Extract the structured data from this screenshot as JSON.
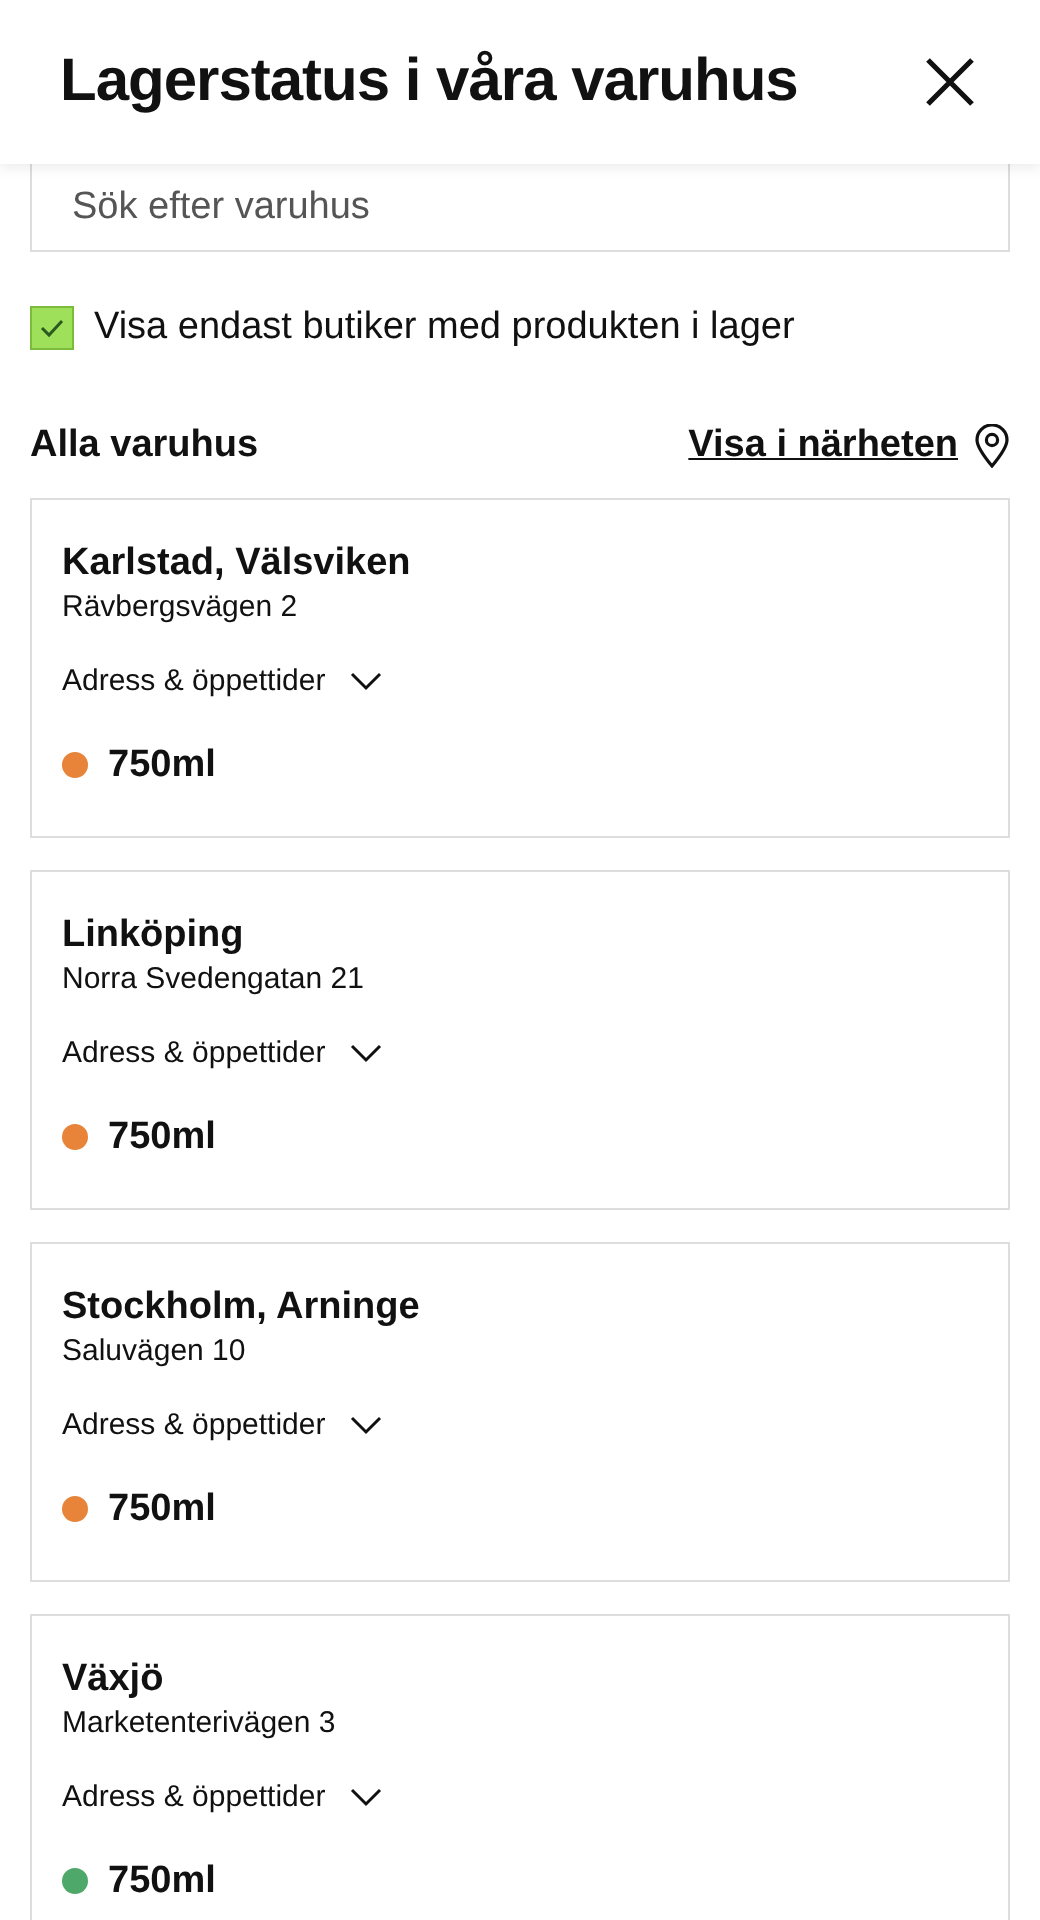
{
  "header": {
    "title": "Lagerstatus i våra varuhus"
  },
  "search": {
    "placeholder": "Sök efter varuhus"
  },
  "filter": {
    "label": "Visa endast butiker med produkten i lager",
    "checked": true
  },
  "list_header": {
    "title": "Alla varuhus",
    "link": "Visa i närheten"
  },
  "stores": [
    {
      "name": "Karlstad, Välsviken",
      "address": "Rävbergsvägen 2",
      "details": "Adress & öppettider",
      "expanded": false,
      "stock": "750ml",
      "color": "#e8833a"
    },
    {
      "name": "Linköping",
      "address": "Norra Svedengatan 21",
      "details": "Adress & öppettider",
      "expanded": false,
      "stock": "750ml",
      "color": "#e8833a"
    },
    {
      "name": "Stockholm, Arninge",
      "address": "Saluvägen 10",
      "details": "Adress & öppettider",
      "expanded": false,
      "stock": "750ml",
      "color": "#e8833a"
    },
    {
      "name": "Växjö",
      "address": "Marketenterivägen 3",
      "details": "Adress & öppettider",
      "expanded": false,
      "stock": "750ml",
      "color": "#4ea86a"
    }
  ]
}
